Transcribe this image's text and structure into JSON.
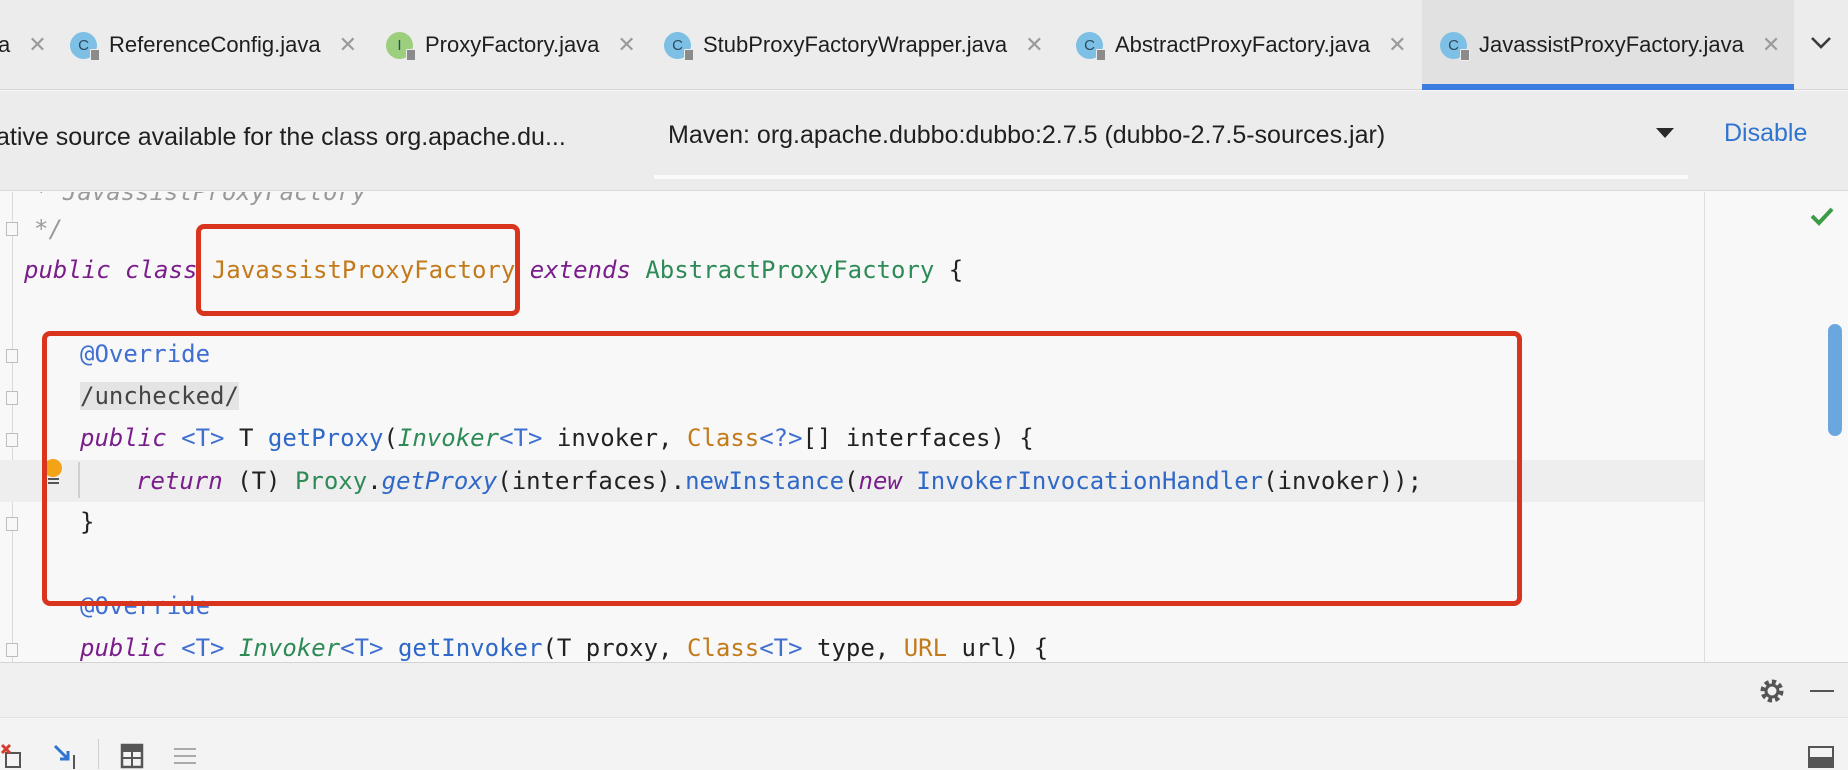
{
  "tabs": [
    {
      "label": "a",
      "icon": "java-file-icon",
      "active": false
    },
    {
      "label": "ReferenceConfig.java",
      "icon": "class-icon",
      "icon_letter": "C",
      "active": false
    },
    {
      "label": "ProxyFactory.java",
      "icon": "interface-icon",
      "icon_letter": "I",
      "active": false
    },
    {
      "label": "StubProxyFactoryWrapper.java",
      "icon": "class-icon",
      "icon_letter": "C",
      "active": false
    },
    {
      "label": "AbstractProxyFactory.java",
      "icon": "abstract-class-icon",
      "icon_letter": "C",
      "active": false
    },
    {
      "label": "JavassistProxyFactory.java",
      "icon": "class-icon",
      "icon_letter": "C",
      "active": true
    }
  ],
  "source_bar": {
    "message": "ative source available for the class org.apache.du...",
    "selected_source": "Maven: org.apache.dubbo:dubbo:2.7.5 (dubbo-2.7.5-sources.jar)",
    "disable_label": "Disable"
  },
  "editor": {
    "comment_end": "*/",
    "class_decl": {
      "public": "public",
      "class": "class",
      "name": "JavassistProxyFactory",
      "extends": "extends",
      "parent": "AbstractProxyFactory",
      "brace": "{"
    },
    "override1": "@Override",
    "unchecked": "/unchecked/",
    "method1": {
      "public": "public",
      "generic": "<T>",
      "ret": "T",
      "name": "getProxy",
      "p1_type": "Invoker",
      "p1_generic": "<T>",
      "p1_name": " invoker, ",
      "p2_type": "Class",
      "p2_generic": "<?>",
      "p2_rest": "[] interfaces) {"
    },
    "return_line": {
      "kw_return": "return",
      "cast": " (T) ",
      "proxy": "Proxy",
      "dot1": ".",
      "get_proxy": "getProxy",
      "args1": "(interfaces).",
      "new_instance": "newInstance",
      "paren": "(",
      "kw_new": "new",
      "handler": "InvokerInvocationHandler",
      "tail": "(invoker));"
    },
    "close_brace": "}",
    "override2": "@Override",
    "method2": {
      "public": "public",
      "generic": "<T>",
      "ret_type": "Invoker",
      "ret_generic": "<T>",
      "name": "getInvoker",
      "p1": "(T proxy, ",
      "p2_type": "Class",
      "p2_generic": "<T>",
      "p2_name": " type, ",
      "p3_type": "URL",
      "p3_rest": " url) {"
    }
  },
  "colors": {
    "accent": "#3a7ce0",
    "highlight_box": "#d8341e",
    "keyword": "#7a1e8c",
    "class_name": "#c27a1a",
    "annotation": "#3f6fd0"
  }
}
